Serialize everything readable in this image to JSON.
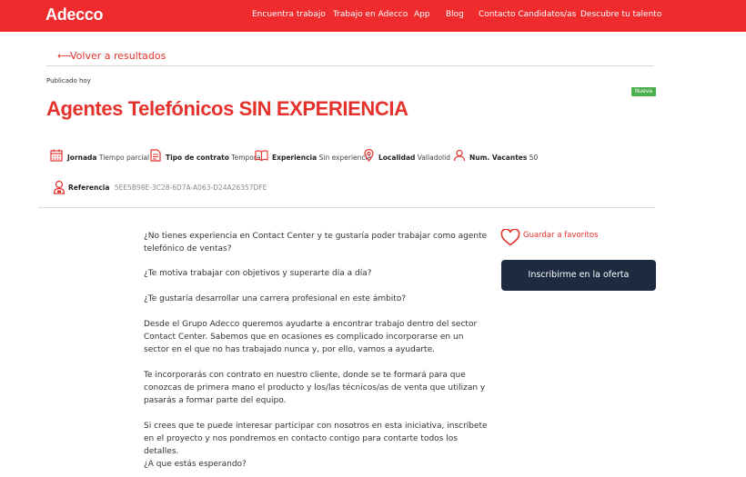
{
  "header": {
    "logo": "Adecco",
    "nav": [
      {
        "label": "Encuentra trabajo"
      },
      {
        "label": "Trabajo en Adecco"
      },
      {
        "label": "App"
      },
      {
        "label": "Blog"
      },
      {
        "label": "Contacto Candidatos/as"
      },
      {
        "label": "Descubre tu talento"
      }
    ]
  },
  "back_link": {
    "arrow": "⟵",
    "label": "Volver a resultados"
  },
  "job": {
    "published": "Publicado hoy",
    "badge": "Nueva",
    "title": "Agentes Telefónicos SIN EXPERIENCIA",
    "meta": {
      "jornada": {
        "label": "Jornada",
        "value": "Tiempo parcial",
        "icon": "calendar-icon"
      },
      "contrato": {
        "label": "Tipo de contrato",
        "value": "Temporal",
        "icon": "document-icon"
      },
      "experiencia": {
        "label": "Experiencia",
        "value": "Sin experiencia",
        "icon": "book-icon"
      },
      "localidad": {
        "label": "Localidad",
        "value": "Valladolid",
        "icon": "location-pin-icon"
      },
      "vacantes": {
        "label": "Num. Vacantes",
        "value": "50",
        "icon": "person-icon"
      },
      "referencia": {
        "label": "Referencia",
        "value": "5EE5B98E-3C28-6D7A-A063-D24A26357DFE",
        "icon": "user-badge-icon"
      }
    },
    "description": [
      "¿No tienes experiencia en Contact Center y te gustaría poder trabajar como agente telefónico de ventas?",
      "¿Te motiva trabajar con objetivos y superarte día a día?",
      "¿Te gustaría desarrollar una carrera profesional en este ámbito?",
      "Desde el Grupo Adecco queremos ayudarte a encontrar trabajo dentro del sector Contact Center. Sabemos que en ocasiones es complicado incorporarse en un sector en el que no has trabajado nunca y, por ello, vamos a ayudarte.",
      "Te incorporarás con contrato en nuestro cliente, donde se te formará para que conozcas de primera mano el producto y los/las técnicos/as de venta que utilizan y pasarás a formar parte del equipo.",
      "Si crees que te puede interesar participar con nosotros en esta iniciativa, inscríbete en el proyecto y nos pondremos en contacto contigo para contarte todos los detalles.",
      "¿A que estás esperando?"
    ]
  },
  "actions": {
    "favorite_label": "Guardar a favoritos",
    "favorite_icon": "heart-icon",
    "apply_label": "Inscribirme en la oferta"
  },
  "colors": {
    "brand_red": "#ef2b2d",
    "button_navy": "#1c2b3f",
    "badge_green": "#4caf50"
  }
}
